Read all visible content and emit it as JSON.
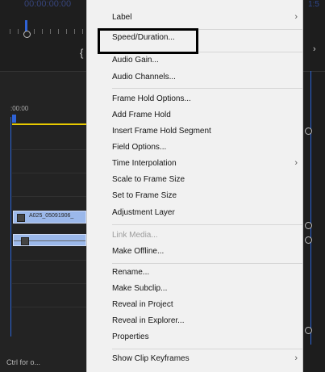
{
  "timeline": {
    "top_timecode": "00:00:00:00",
    "timecode": ":00:00",
    "clip_1_label": "A025_05091906_",
    "status_text": "Ctrl for o...",
    "right_top_text": "1:5",
    "right_chevron": "›",
    "brace": "{"
  },
  "context_menu": {
    "items": [
      {
        "label": "Label",
        "submenu": true,
        "disabled": false
      },
      {
        "label": "Speed/Duration...",
        "submenu": false,
        "disabled": false,
        "highlighted": true
      },
      {
        "label": "Audio Gain...",
        "submenu": false,
        "disabled": false
      },
      {
        "label": "Audio Channels...",
        "submenu": false,
        "disabled": false
      },
      {
        "label": "Frame Hold Options...",
        "submenu": false,
        "disabled": false
      },
      {
        "label": "Add Frame Hold",
        "submenu": false,
        "disabled": false
      },
      {
        "label": "Insert Frame Hold Segment",
        "submenu": false,
        "disabled": false
      },
      {
        "label": "Field Options...",
        "submenu": false,
        "disabled": false
      },
      {
        "label": "Time Interpolation",
        "submenu": true,
        "disabled": false
      },
      {
        "label": "Scale to Frame Size",
        "submenu": false,
        "disabled": false
      },
      {
        "label": "Set to Frame Size",
        "submenu": false,
        "disabled": false
      },
      {
        "label": "Adjustment Layer",
        "submenu": false,
        "disabled": false
      },
      {
        "label": "Link Media...",
        "submenu": false,
        "disabled": true
      },
      {
        "label": "Make Offline...",
        "submenu": false,
        "disabled": false
      },
      {
        "label": "Rename...",
        "submenu": false,
        "disabled": false
      },
      {
        "label": "Make Subclip...",
        "submenu": false,
        "disabled": false
      },
      {
        "label": "Reveal in Project",
        "submenu": false,
        "disabled": false
      },
      {
        "label": "Reveal in Explorer...",
        "submenu": false,
        "disabled": false
      },
      {
        "label": "Properties",
        "submenu": false,
        "disabled": false
      },
      {
        "label": "Show Clip Keyframes",
        "submenu": true,
        "disabled": false
      }
    ],
    "submenu_arrow": "›"
  },
  "colors": {
    "menu_background": "#f1f1f1",
    "timeline_background": "#232323",
    "accent_blue": "#2a65d8",
    "clip_blue": "#9bb8ea",
    "playhead_yellow": "#e7c900",
    "highlight_border": "#000000"
  },
  "icons": [
    "chevron-right-icon",
    "playhead-icon",
    "clip-badge-icon",
    "keyframe-circle-icon"
  ]
}
